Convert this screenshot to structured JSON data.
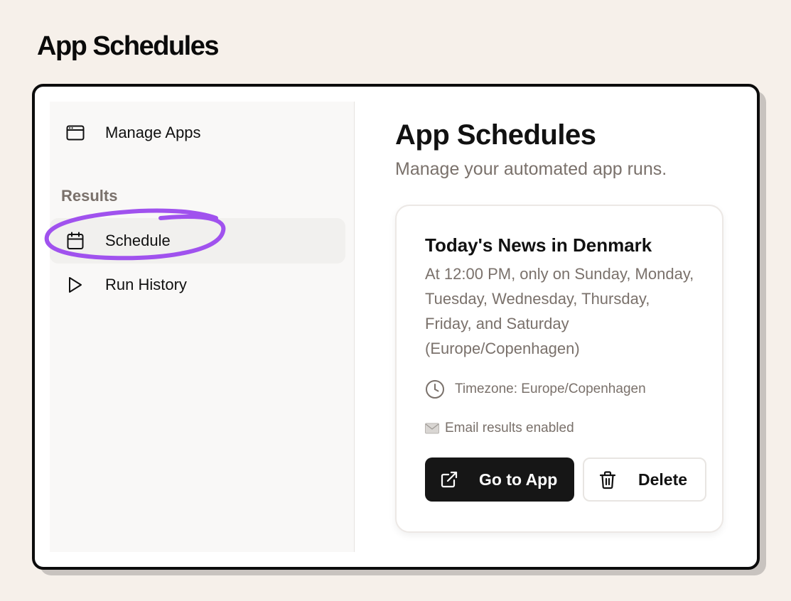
{
  "page": {
    "heading": "App Schedules"
  },
  "sidebar": {
    "items": [
      {
        "label": "Manage Apps",
        "icon": "app-window-icon"
      },
      {
        "label": "Schedule",
        "icon": "calendar-icon",
        "active": true
      },
      {
        "label": "Run History",
        "icon": "play-icon"
      }
    ],
    "section_label": "Results",
    "highlight_color": "#a052ee"
  },
  "main": {
    "title": "App Schedules",
    "subtitle": "Manage your automated app runs."
  },
  "schedule_card": {
    "title": "Today's News in Denmark",
    "description": "At 12:00 PM, only on Sunday, Monday, Tuesday, Wednesday, Thursday, Friday, and Saturday (Europe/Copenhagen)",
    "timezone": "Timezone: Europe/Copenhagen",
    "email": "Email results enabled",
    "go_button": "Go to App",
    "delete_button": "Delete"
  }
}
